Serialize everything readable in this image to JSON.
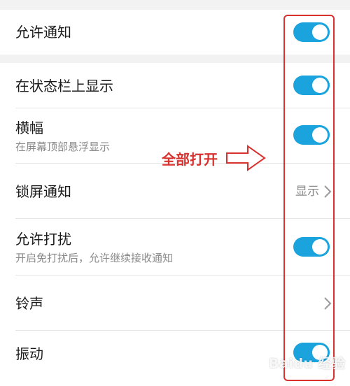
{
  "colors": {
    "accent": "#1ba3dd",
    "annotation": "#d8322f"
  },
  "settings": {
    "allow_notifications": {
      "title": "允许通知",
      "toggle": "on"
    },
    "status_bar": {
      "title": "在状态栏上显示",
      "toggle": "on"
    },
    "banner": {
      "title": "横幅",
      "subtitle": "在屏幕顶部悬浮显示",
      "toggle": "on"
    },
    "lock_screen": {
      "title": "锁屏通知",
      "value": "显示",
      "icon": "chevron-right-icon"
    },
    "allow_dnd": {
      "title": "允许打扰",
      "subtitle": "开启免打扰后，允许继续接收通知",
      "toggle": "on"
    },
    "ringtone": {
      "title": "铃声",
      "icon": "chevron-right-icon"
    },
    "vibration": {
      "title": "振动",
      "toggle": "on"
    }
  },
  "annotation": {
    "label": "全部打开",
    "icon": "outline-arrow-right-icon"
  },
  "watermark": {
    "text": "Baidu 经验"
  }
}
